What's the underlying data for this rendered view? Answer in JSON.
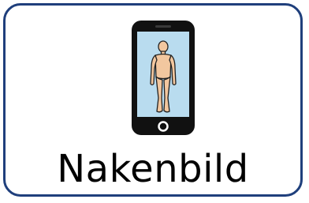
{
  "card": {
    "label": "Nakenbild",
    "icon": "phone-with-naked-person-icon",
    "border_color": "#1f3f7c"
  }
}
